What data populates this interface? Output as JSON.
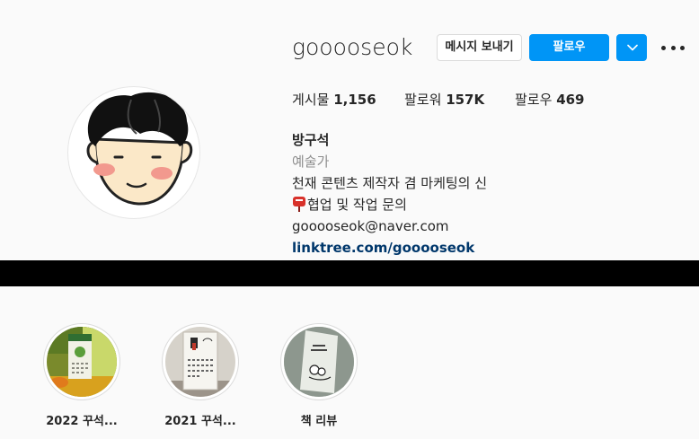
{
  "profile": {
    "username": "gooooseok",
    "message_button": "메시지 보내기",
    "follow_button": "팔로우",
    "stats": {
      "posts_label": "게시물",
      "posts_value": "1,156",
      "followers_label": "팔로워",
      "followers_value": "157K",
      "following_label": "팔로우",
      "following_value": "469"
    },
    "bio": {
      "name": "방구석",
      "category": "예술가",
      "line1": "천재 콘텐츠 제작자 겸 마케팅의 신",
      "line2": "협업 및 작업 문의",
      "email": "gooooseok@naver.com",
      "link": "linktree.com/gooooseok"
    }
  },
  "highlights": [
    {
      "label": "2022 꾸석..."
    },
    {
      "label": "2021 꾸석..."
    },
    {
      "label": "책 리뷰"
    }
  ],
  "icons": {
    "suggest": "chevron-down-icon",
    "more": "more-options-icon",
    "pin": "mailbox-emoji-icon"
  },
  "colors": {
    "accent": "#0095f6",
    "link": "#00376b",
    "muted": "#8e8e8e",
    "text": "#262626"
  }
}
